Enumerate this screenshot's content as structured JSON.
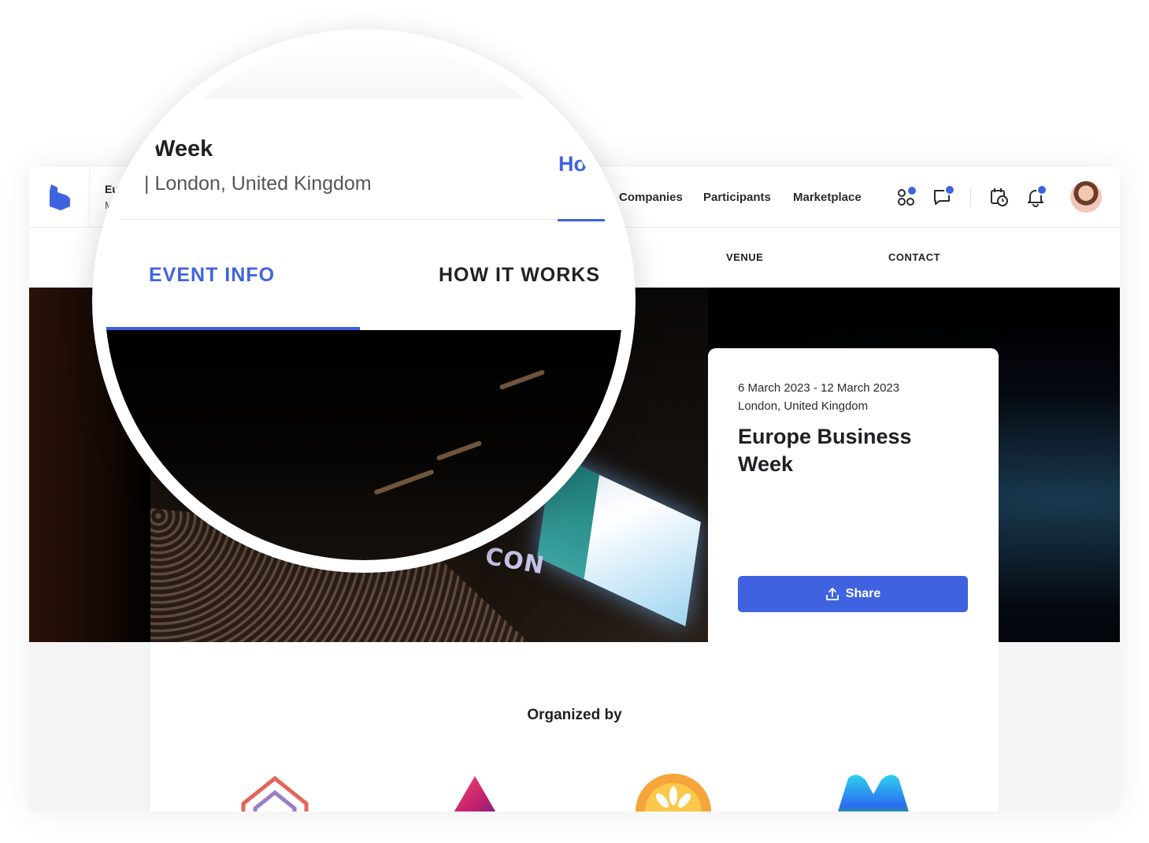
{
  "header": {
    "event_title": "Eu",
    "event_sub": "M",
    "nav": [
      "Companies",
      "Participants",
      "Marketplace"
    ]
  },
  "tabs": {
    "visible": [
      "VENUE",
      "CONTACT"
    ]
  },
  "event": {
    "date_range": "6 March 2023 - 12 March 2023",
    "location": "London, United Kingdom",
    "title": "Europe Business Week",
    "share_label": "Share"
  },
  "organizers": {
    "title": "Organized by"
  },
  "magnifier": {
    "title_fragment": "Week",
    "location_fragment": "| London, United Kingdom",
    "tab_fragment": "Ho",
    "tab_active": "EVENT INFO",
    "tab_next": "HOW IT WORKS"
  },
  "hero_sign": "CON",
  "colors": {
    "accent": "#3f63e0",
    "text": "#1f2023",
    "background": "#f4f4f5"
  },
  "icons": [
    "app-logo-icon",
    "apps-icon",
    "chat-icon",
    "calendar-clock-icon",
    "bell-icon",
    "upload-icon"
  ]
}
